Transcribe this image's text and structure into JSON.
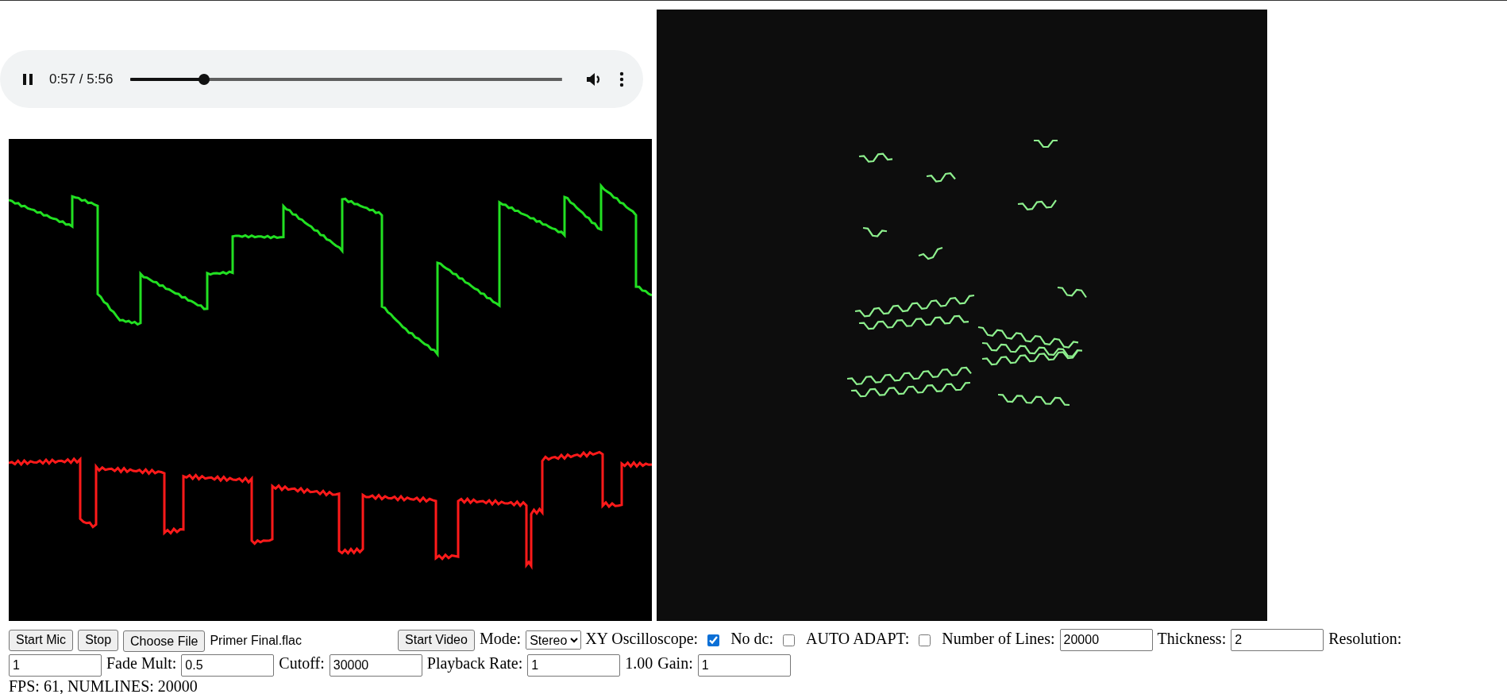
{
  "player": {
    "playing": true,
    "time": "0:57 / 5:56",
    "level": 0.17
  },
  "controls": [
    {
      "kind": "button",
      "label": "Start Mic"
    },
    {
      "kind": "button",
      "label": "Stop"
    },
    {
      "kind": "file",
      "button": "Choose File",
      "filename": "Primer Final.flac"
    },
    {
      "kind": "button",
      "label": "Start Video"
    },
    {
      "kind": "text",
      "text": "Mode:"
    },
    {
      "kind": "select",
      "value": "Stereo"
    },
    {
      "kind": "text",
      "text": "XY Oscilloscope:"
    },
    {
      "kind": "checkbox",
      "checked": true
    },
    {
      "kind": "text",
      "text": "No dc:"
    },
    {
      "kind": "checkbox",
      "checked": false
    },
    {
      "kind": "text",
      "text": "AUTO ADAPT:"
    },
    {
      "kind": "checkbox",
      "checked": false
    },
    {
      "kind": "text",
      "text": "Number of Lines:"
    },
    {
      "kind": "input",
      "value": "20000"
    },
    {
      "kind": "text",
      "text": "Thickness:"
    },
    {
      "kind": "input",
      "value": "2"
    },
    {
      "kind": "text",
      "text": "Resolution:"
    },
    {
      "kind": "input",
      "value": "1"
    },
    {
      "kind": "text",
      "text": "Fade Mult:"
    },
    {
      "kind": "input",
      "value": "0.5"
    },
    {
      "kind": "text",
      "text": "Cutoff:"
    },
    {
      "kind": "input",
      "value": "30000"
    },
    {
      "kind": "text",
      "text": "Playback Rate:"
    },
    {
      "kind": "input",
      "value": "1"
    },
    {
      "kind": "text",
      "text": "1.00"
    },
    {
      "kind": "text",
      "text": "Gain:"
    },
    {
      "kind": "input",
      "value": "1"
    }
  ],
  "status": "FPS: 61, NUMLINES: 20000"
}
